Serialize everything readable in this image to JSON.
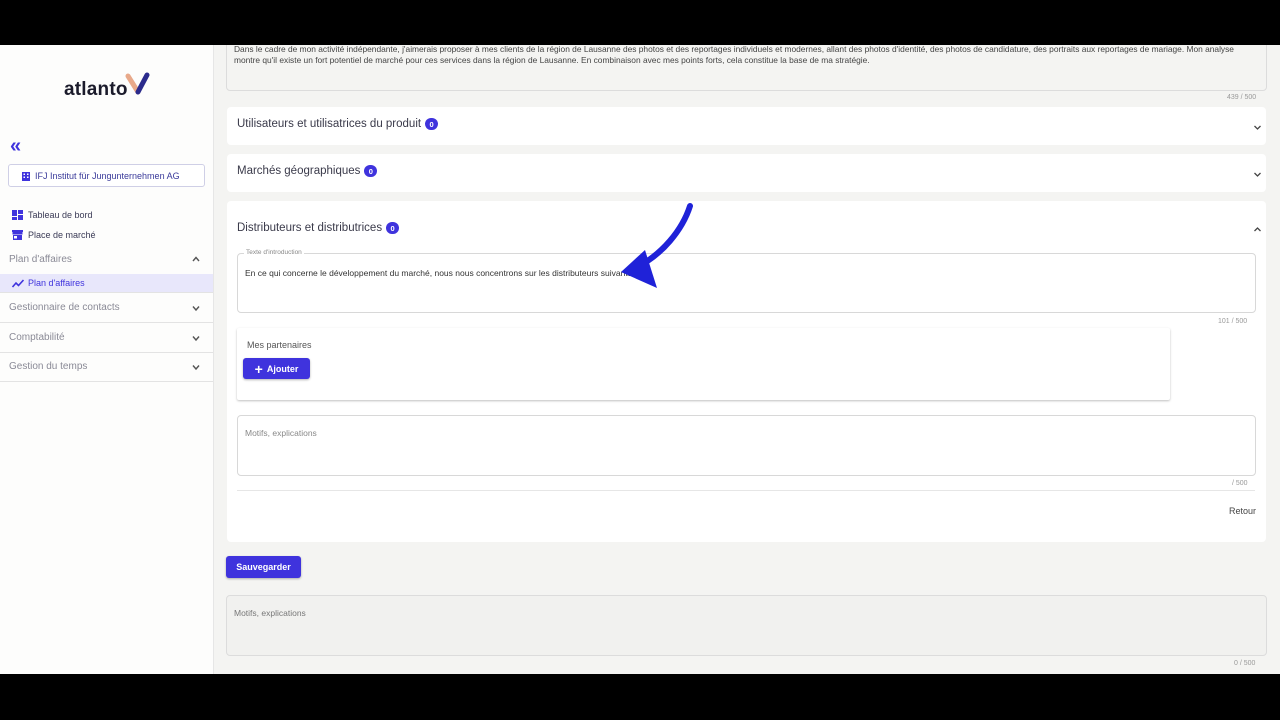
{
  "app": {
    "logo_text": "atlanto"
  },
  "sidebar": {
    "collapse_glyph": "«",
    "organization": "IFJ Institut für Jungunternehmen AG",
    "links": [
      {
        "label": "Tableau de bord",
        "icon": "dashboard-icon"
      },
      {
        "label": "Place de marché",
        "icon": "store-icon"
      }
    ],
    "groups": {
      "plan": "Plan d'affaires",
      "plan_active_item": "Plan d'affaires",
      "contacts": "Gestionnaire de contacts",
      "comptabilite": "Comptabilité",
      "temps": "Gestion du temps"
    }
  },
  "main": {
    "top_text": "Dans le cadre de mon activité indépendante, j'aimerais proposer à mes clients de la région de Lausanne des photos et des reportages individuels et modernes, allant des photos d'identité, des photos de candidature, des portraits aux reportages de mariage. Mon analyse montre qu'il existe un fort potentiel de marché pour ces services dans la région de Lausanne. En combinaison avec mes points forts, cela constitue la base de ma stratégie.",
    "top_counter": "439 / 500",
    "panels": [
      {
        "title": "Utilisateurs et utilisatrices du produit",
        "count": "0"
      },
      {
        "title": "Marchés géographiques",
        "count": "0"
      },
      {
        "title": "Distributeurs et distributrices",
        "count": "0"
      }
    ],
    "intro_label": "Texte d'introduction",
    "intro_value": "En ce qui concerne le développement du marché, nous nous concentrons sur les distributeurs suivants :",
    "intro_counter": "101 / 500",
    "partners_label": "Mes partenaires",
    "add_button": "Ajouter",
    "motifs_placeholder": "Motifs, explications",
    "motifs_counter": "/ 500",
    "back_button": "Retour",
    "save_button": "Sauvegarder",
    "bottom_placeholder": "Motifs, explications",
    "bottom_counter": "0 / 500"
  },
  "colors": {
    "accent": "#3f33dd",
    "annotation_arrow": "#1f22d8"
  }
}
